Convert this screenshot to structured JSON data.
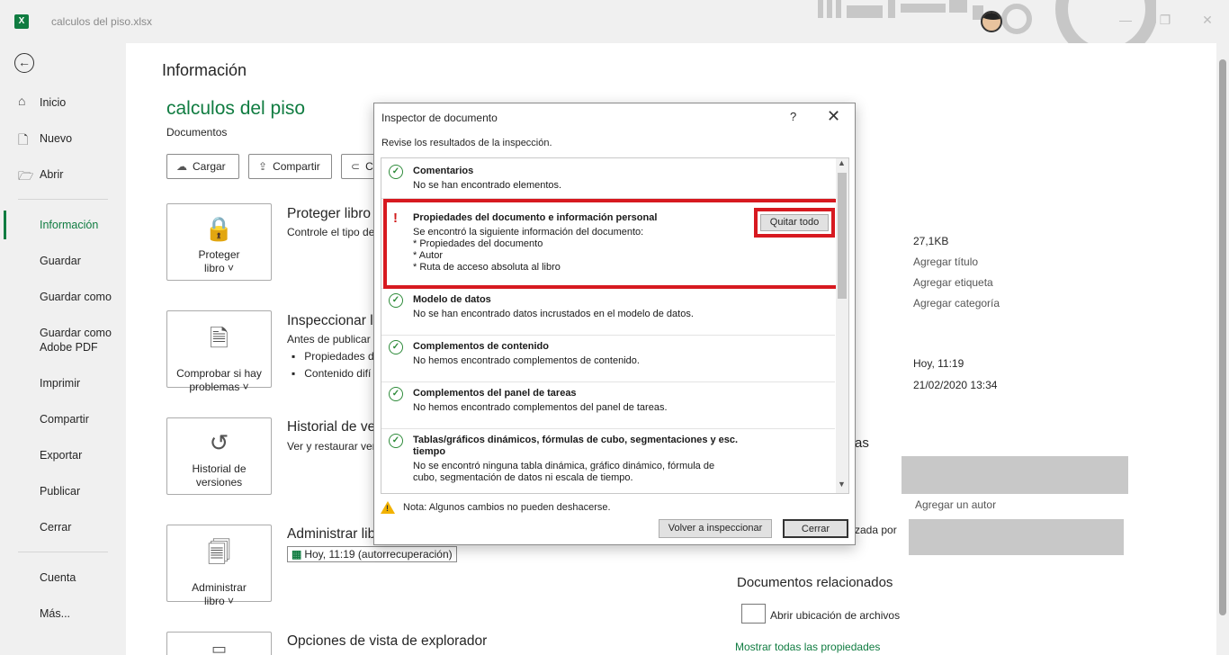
{
  "titlebar": {
    "file_name": "calculos del piso.xlsx",
    "logo": "X"
  },
  "nav": {
    "items": [
      "Inicio",
      "Nuevo",
      "Abrir",
      "Información",
      "Guardar",
      "Guardar como",
      "Guardar como Adobe PDF",
      "Imprimir",
      "Compartir",
      "Exportar",
      "Publicar",
      "Cerrar",
      "Cuenta",
      "Más..."
    ],
    "active": "Información"
  },
  "main": {
    "heading": "Información",
    "workbook_name": "calculos del piso",
    "location": "Documentos",
    "top_buttons": [
      "Cargar",
      "Compartir",
      "C"
    ],
    "sections": [
      {
        "card_label": "Proteger libro ˅",
        "title": "Proteger libro",
        "desc": "Controle el tipo de"
      },
      {
        "card_label": "Comprobar si hay problemas ˅",
        "title": "Inspeccionar li",
        "desc": "Antes de publicar",
        "bullets": [
          "Propiedades d",
          "Contenido difí"
        ]
      },
      {
        "card_label": "Historial de versiones",
        "title": "Historial de ve",
        "desc": "Ver y restaurar vers"
      },
      {
        "card_label": "Administrar libro ˅",
        "title": "Administrar lib",
        "autorecovery": "Hoy, 11:19 (autorrecuperación)"
      },
      {
        "card_label": "",
        "title": "Opciones de vista de explorador"
      }
    ],
    "properties": {
      "size": "27,1KB",
      "title": "Agregar título",
      "tags": "Agregar etiqueta",
      "category": "Agregar categoría",
      "modified": "Hoy, 11:19",
      "created": "21/02/2020 13:34",
      "people_tail": "as",
      "add_author": "Agregar un autor",
      "modified_by_tail": "zada por"
    },
    "related": {
      "heading": "Documentos relacionados",
      "open_location": "Abrir ubicación de archivos",
      "show_all": "Mostrar todas las propiedades"
    }
  },
  "dialog": {
    "title": "Inspector de documento",
    "help": "?",
    "prompt": "Revise los resultados de la inspección.",
    "results": [
      {
        "title": "Comentarios",
        "desc": [
          "No se han encontrado elementos."
        ],
        "status": "ok"
      },
      {
        "title": "Propiedades del documento e información personal",
        "desc": [
          "Se encontró la siguiente información del documento:",
          "* Propiedades del documento",
          "* Autor",
          "* Ruta de acceso absoluta al libro"
        ],
        "status": "found"
      },
      {
        "title": "Modelo de datos",
        "desc": [
          "No se han encontrado datos incrustados en el modelo de datos."
        ],
        "status": "ok"
      },
      {
        "title": "Complementos de contenido",
        "desc": [
          "No hemos encontrado complementos de contenido."
        ],
        "status": "ok"
      },
      {
        "title": "Complementos del panel de tareas",
        "desc": [
          "No hemos encontrado complementos del panel de tareas."
        ],
        "status": "ok"
      },
      {
        "title": "Tablas/gráficos dinámicos, fórmulas de cubo, segmentaciones y esc. tiempo",
        "title_lines": [
          "Tablas/gráficos dinámicos, fórmulas de cubo, segmentaciones y esc.",
          "tiempo"
        ],
        "desc": [
          "No se encontró ninguna tabla dinámica, gráfico dinámico, fórmula de",
          "cubo, segmentación de datos ni escala de tiempo."
        ],
        "status": "ok"
      }
    ],
    "remove_all": "Quitar todo",
    "note": "Nota: Algunos cambios no pueden deshacerse.",
    "reinspect": "Volver a inspeccionar",
    "close": "Cerrar"
  },
  "colors": {
    "accent": "#107c41",
    "highlight": "#d71920"
  }
}
